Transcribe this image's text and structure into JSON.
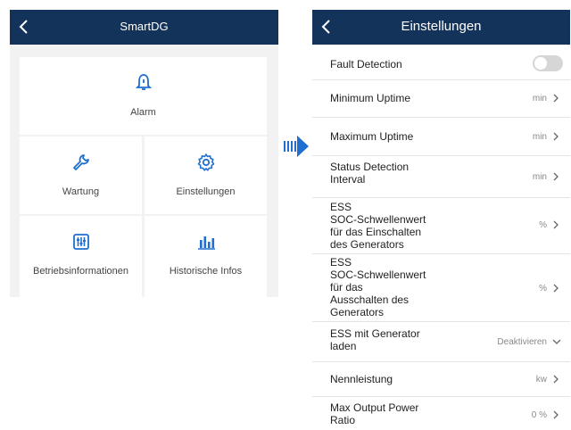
{
  "left_screen": {
    "header": {
      "title": "SmartDG"
    },
    "items": [
      {
        "label": "Alarm",
        "icon": "bell-icon"
      },
      {
        "label": "Wartung",
        "icon": "wrench-icon"
      },
      {
        "label": "Einstellungen",
        "icon": "gear-icon"
      },
      {
        "label": "Betriebsinformationen",
        "icon": "sliders-icon"
      },
      {
        "label": "Historische Infos",
        "icon": "bar-chart-icon"
      }
    ]
  },
  "right_screen": {
    "header": {
      "title": "Einstellungen"
    },
    "rows": [
      {
        "label": "Fault Detection",
        "value": "",
        "control": "toggle-off"
      },
      {
        "label": "Minimum Uptime",
        "value": "min"
      },
      {
        "label": "Maximum Uptime",
        "value": "min"
      },
      {
        "label": "Status Detection\nInterval",
        "value": "min"
      },
      {
        "label": "ESS\nSOC-Schwellenwert\nfür das Einschalten\ndes Generators",
        "value": "%"
      },
      {
        "label": "ESS\nSOC-Schwellenwert\nfür das\nAusschalten des\nGenerators",
        "value": "%"
      },
      {
        "label": "ESS mit Generator\nladen",
        "value": "Deaktivieren",
        "control": "dropdown"
      },
      {
        "label": "Nennleistung",
        "value": "kw"
      },
      {
        "label": "Max Output Power\nRatio",
        "value": "0 %"
      }
    ]
  },
  "colors": {
    "header_bg": "#14335a",
    "icon_blue": "#1e6fd0"
  }
}
